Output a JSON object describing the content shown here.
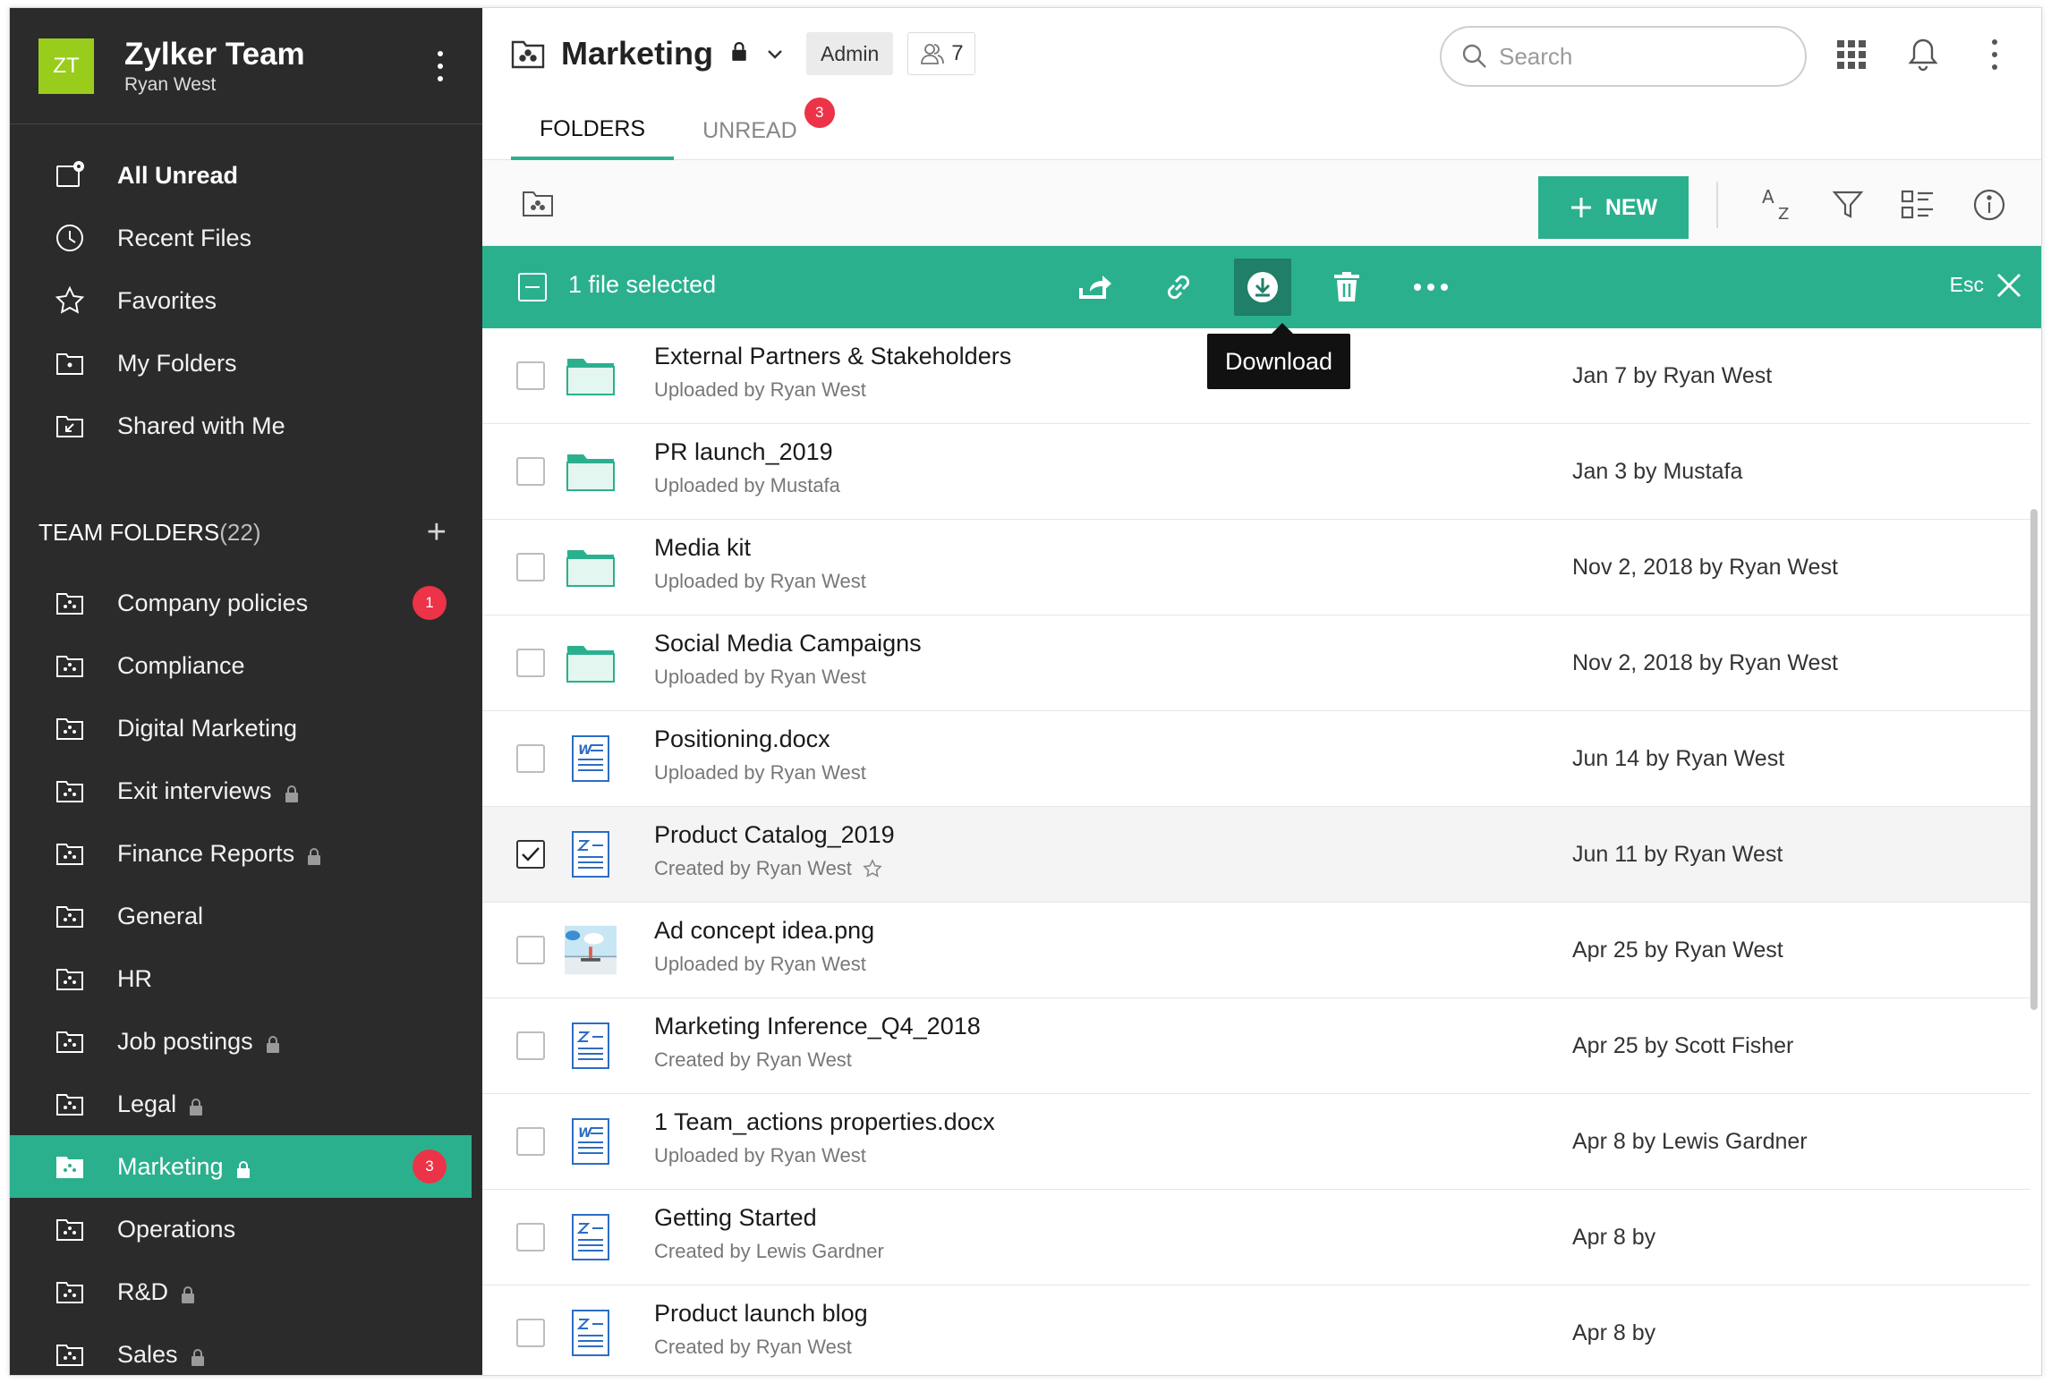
{
  "team": {
    "initials": "ZT",
    "name": "Zylker Team",
    "user": "Ryan West"
  },
  "nav": [
    {
      "label": "All Unread",
      "icon": "unread-icon",
      "bold": true
    },
    {
      "label": "Recent Files",
      "icon": "clock-icon"
    },
    {
      "label": "Favorites",
      "icon": "star-icon"
    },
    {
      "label": "My Folders",
      "icon": "folder-icon"
    },
    {
      "label": "Shared with Me",
      "icon": "shared-folder-icon"
    }
  ],
  "team_folders": {
    "label": "TEAM FOLDERS",
    "count": "(22)",
    "add": "+",
    "items": [
      {
        "label": "Company policies",
        "locked": false,
        "badge": "1"
      },
      {
        "label": "Compliance",
        "locked": false
      },
      {
        "label": "Digital Marketing",
        "locked": false
      },
      {
        "label": "Exit interviews",
        "locked": true
      },
      {
        "label": "Finance Reports",
        "locked": true
      },
      {
        "label": "General",
        "locked": false
      },
      {
        "label": "HR",
        "locked": false
      },
      {
        "label": "Job postings",
        "locked": true
      },
      {
        "label": "Legal",
        "locked": true
      },
      {
        "label": "Marketing",
        "locked": true,
        "badge": "3",
        "active": true
      },
      {
        "label": "Operations",
        "locked": false
      },
      {
        "label": "R&D",
        "locked": true
      },
      {
        "label": "Sales",
        "locked": true
      }
    ]
  },
  "header": {
    "title": "Marketing",
    "role": "Admin",
    "members": "7",
    "search_placeholder": "Search"
  },
  "tabs": [
    {
      "label": "FOLDERS",
      "active": true
    },
    {
      "label": "UNREAD",
      "badge": "3"
    }
  ],
  "toolbar": {
    "new_label": "NEW"
  },
  "selection": {
    "text": "1 file selected",
    "esc": "Esc",
    "tooltip": "Download"
  },
  "files": [
    {
      "name": "External Partners & Stakeholders",
      "sub": "Uploaded by Ryan West",
      "date": "Jan 7 by Ryan West",
      "type": "folder"
    },
    {
      "name": "PR launch_2019",
      "sub": "Uploaded by Mustafa",
      "date": "Jan 3 by Mustafa",
      "type": "folder"
    },
    {
      "name": "Media kit",
      "sub": "Uploaded by Ryan West",
      "date": "Nov 2, 2018 by Ryan West",
      "type": "folder"
    },
    {
      "name": "Social Media Campaigns",
      "sub": "Uploaded by Ryan West",
      "date": "Nov 2, 2018 by Ryan West",
      "type": "folder"
    },
    {
      "name": "Positioning.docx",
      "sub": "Uploaded by Ryan West",
      "date": "Jun 14 by Ryan West",
      "type": "word"
    },
    {
      "name": "Product Catalog_2019",
      "sub": "Created by Ryan West",
      "date": "Jun 11 by Ryan West",
      "type": "zdoc",
      "selected": true,
      "star": true
    },
    {
      "name": "Ad concept idea.png",
      "sub": "Uploaded by Ryan West",
      "date": "Apr 25 by Ryan West",
      "type": "image"
    },
    {
      "name": "Marketing Inference_Q4_2018",
      "sub": "Created by Ryan West",
      "date": "Apr 25 by Scott Fisher",
      "type": "zdoc"
    },
    {
      "name": "1 Team_actions properties.docx",
      "sub": "Uploaded by Ryan West",
      "date": "Apr 8 by Lewis Gardner",
      "type": "word"
    },
    {
      "name": "Getting Started",
      "sub": "Created by Lewis Gardner",
      "date": "Apr 8 by",
      "type": "zdoc"
    },
    {
      "name": "Product launch blog",
      "sub": "Created by Ryan West",
      "date": "Apr 8 by",
      "type": "zdoc"
    }
  ],
  "colors": {
    "accent": "#2bb08e",
    "sidebar": "#2b2b2b",
    "badge": "#ec3347",
    "avatar": "#9acd1b"
  }
}
